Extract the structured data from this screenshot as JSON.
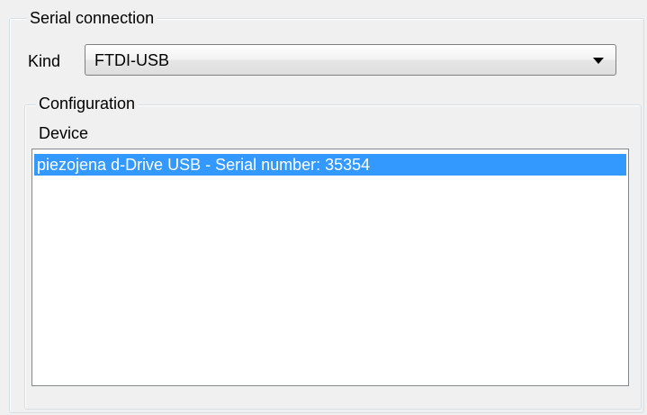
{
  "serial_connection": {
    "title": "Serial connection",
    "kind": {
      "label": "Kind",
      "selected_value": "FTDI-USB"
    },
    "configuration": {
      "title": "Configuration",
      "device_label": "Device",
      "devices": [
        {
          "label": "piezojena d-Drive USB - Serial number: 35354",
          "selected": true
        }
      ]
    }
  },
  "colors": {
    "selection_background": "#3399ff",
    "selection_text": "#ffffff",
    "window_background": "#f0f0f0",
    "groupbox_border": "#d5dfe5"
  },
  "icons": {
    "combo_dropdown": "chevron-down-icon"
  }
}
